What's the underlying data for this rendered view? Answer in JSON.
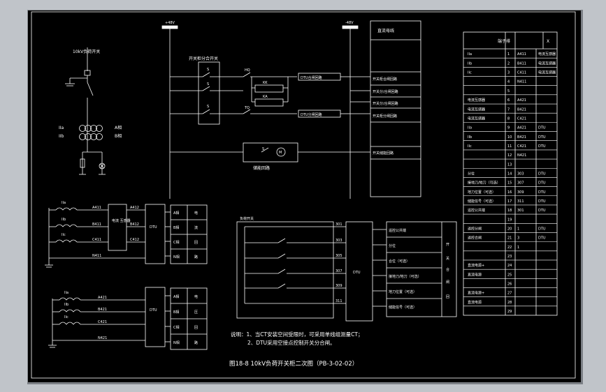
{
  "title": "图18-8 10kV负荷开关柜二次图（PB-3-02-02）",
  "notes": [
    "说明：1、当CT安装空间受限时，可采用单线组测量CT；",
    "2、DTU采用空接点控制开关分合闸。"
  ],
  "bus": {
    "left": "+48V",
    "right": "-48V"
  },
  "top_section": {
    "main_switch_label": "10kV负荷开关",
    "interlock_switch_label": "开关柜分合开关",
    "close_coil": "HQ",
    "trip_coil": "TQ",
    "contact_label": "S",
    "motor_label": "M",
    "relay_labels": [
      "KK",
      "KA"
    ],
    "close_circuit_label": "DTU合闸回路",
    "trip_circuit_label": "DTU分闸回路",
    "storage_motor_label": "储能回路",
    "bus_box_title": "直流母线",
    "function_list": [
      "开关柜合闸回路",
      "开关分/合闸回路",
      "开关分/合闸回路",
      "开关柜分闸回路",
      "开关储能回路"
    ],
    "pt_labels": [
      "IIa",
      "IIb"
    ],
    "pt_side_labels": [
      "A相",
      "B相"
    ]
  },
  "ct1": {
    "phases": [
      "IIa",
      "IIb",
      "IIc"
    ],
    "terminals": [
      "A411",
      "B411",
      "C411",
      "N411"
    ],
    "box_label": "电流\n互感器",
    "out_terminals": [
      "A412",
      "B412",
      "C412"
    ],
    "dtu_label": "DTU",
    "rows": [
      "A相",
      "B相",
      "C相",
      "N相"
    ],
    "right_labels": [
      "电",
      "流",
      "回",
      "路"
    ]
  },
  "ct2": {
    "phases": [
      "IIa",
      "IIb",
      "IIc"
    ],
    "terminals": [
      "A421",
      "B421",
      "C421",
      "N421"
    ],
    "dtu_label": "DTU",
    "rows": [
      "A相",
      "B相",
      "C相",
      "N相"
    ],
    "right_labels": [
      "电",
      "压",
      "回",
      "路"
    ]
  },
  "aux_switch": {
    "title": "负荷开关",
    "terminals": [
      "301",
      "303",
      "305",
      "307",
      "309",
      "311"
    ],
    "dtu_label": "DTU"
  },
  "signal_table": {
    "rows": [
      "遥控公共端",
      "分位",
      "合位（可选）",
      "接地刀/地刀（可选）",
      "地刀位置（可选）",
      "储能信号（可选）"
    ],
    "right_col": [
      "开",
      "关",
      "合",
      "闸",
      "回"
    ]
  },
  "terminal_block": {
    "header": [
      "端子排",
      "X"
    ],
    "rows": [
      [
        "IIa",
        "1",
        "A411",
        "电流互感器"
      ],
      [
        "IIb",
        "2",
        "B411",
        "电流互感器"
      ],
      [
        "IIc",
        "3",
        "C411",
        "电流互感器"
      ],
      [
        "",
        "4",
        "N411",
        ""
      ],
      [
        "",
        "5",
        "",
        ""
      ],
      [
        "电流互感器",
        "6",
        "A421",
        ""
      ],
      [
        "电流互感器",
        "7",
        "B421",
        ""
      ],
      [
        "电流互感器",
        "8",
        "C421",
        ""
      ],
      [
        "IIa",
        "9",
        "A421",
        "DTU"
      ],
      [
        "IIb",
        "10",
        "B421",
        "DTU"
      ],
      [
        "IIc",
        "11",
        "C421",
        "DTU"
      ],
      [
        "",
        "12",
        "N421",
        ""
      ],
      [
        "",
        "13",
        "",
        ""
      ],
      [
        "分位",
        "14",
        "303",
        "DTU"
      ],
      [
        "接地刀/地刀（可选）",
        "15",
        "307",
        "DTU"
      ],
      [
        "地刀位置（可选）",
        "16",
        "309",
        "DTU"
      ],
      [
        "储能信号（可选）",
        "17",
        "311",
        "DTU"
      ],
      [
        "遥控公共端",
        "18",
        "301",
        "DTU"
      ],
      [
        "",
        "19",
        "",
        ""
      ],
      [
        "遥控分闸",
        "20",
        "1",
        "DTU"
      ],
      [
        "遥控合闸",
        "21",
        "3",
        "DTU"
      ],
      [
        "",
        "22",
        "1",
        ""
      ],
      [
        "",
        "23",
        "",
        ""
      ],
      [
        "直流电源+",
        "24",
        "",
        ""
      ],
      [
        "直流电源",
        "25",
        "",
        ""
      ],
      [
        "",
        "26",
        "",
        ""
      ],
      [
        "直流电源+",
        "27",
        "",
        ""
      ],
      [
        "直流电源",
        "28",
        "",
        ""
      ],
      [
        "",
        "29",
        "",
        ""
      ]
    ]
  }
}
